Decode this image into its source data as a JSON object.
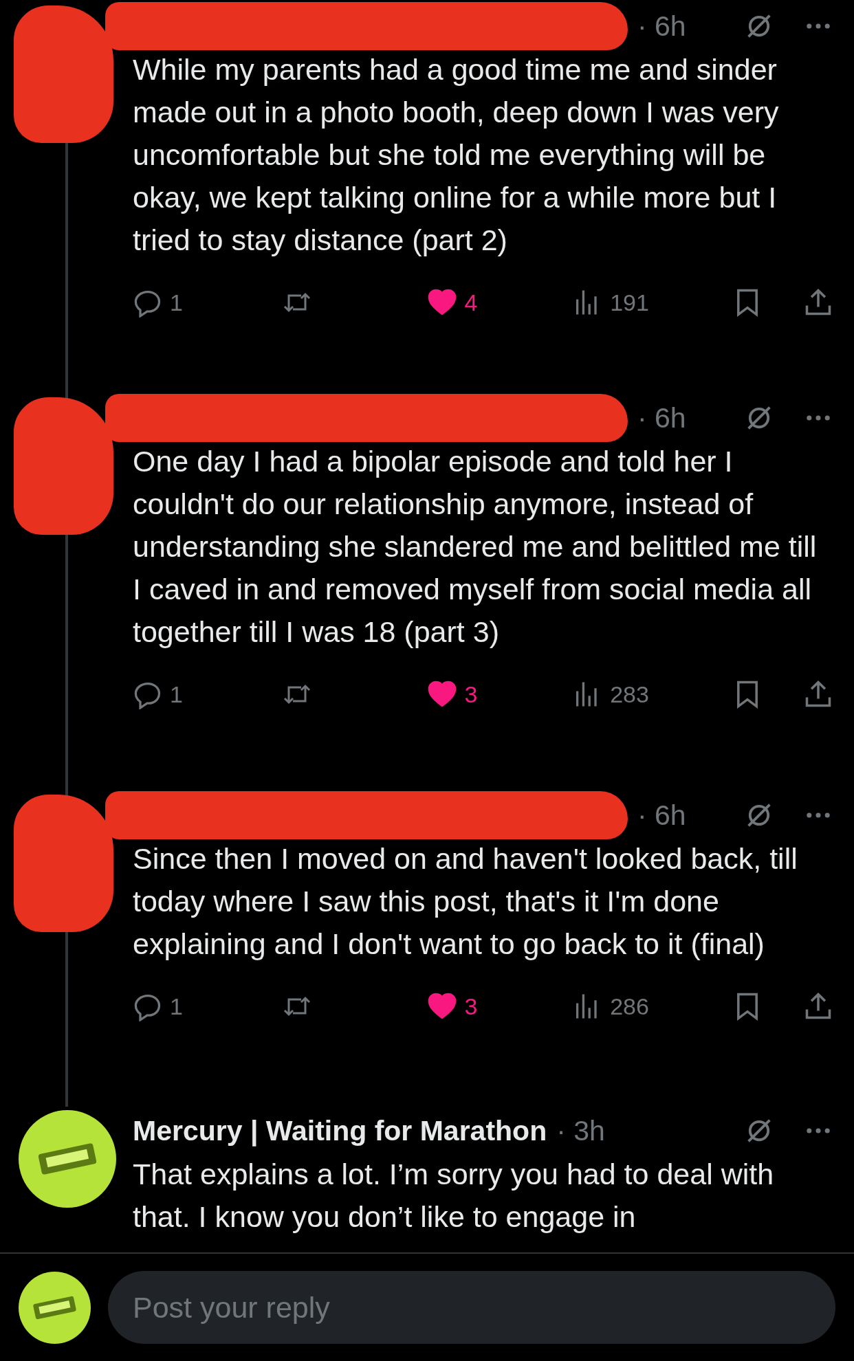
{
  "tweets": [
    {
      "author_redacted": true,
      "time": "· 6h",
      "text": "While my parents had a good time me and sinder made out in a photo booth, deep down I was very uncomfortable but she told me everything will be okay, we kept talking online for a while more but I tried to stay distance (part 2)",
      "replies": "1",
      "likes": "4",
      "liked": true,
      "views": "191",
      "thread": true
    },
    {
      "author_redacted": true,
      "time": "· 6h",
      "text": "One day I had a bipolar episode and told her I couldn't do our relationship anymore, instead of understanding she slandered me and belittled me till I caved in and removed myself from social media all together till I was 18 (part 3)",
      "replies": "1",
      "likes": "3",
      "liked": true,
      "views": "283",
      "thread": true
    },
    {
      "author_redacted": true,
      "time": "· 6h",
      "text": "Since then I moved on and haven't looked back, till today where I saw this post, that's it I'm done explaining and I don't want to go back to it (final)",
      "replies": "1",
      "likes": "3",
      "liked": true,
      "views": "286",
      "thread": true
    },
    {
      "author_redacted": false,
      "author": "Mercury | Waiting for Marathon",
      "time": "· 3h",
      "text": "That explains a lot. I’m sorry you had to deal with that. I know you don’t like to engage in",
      "thread": false
    }
  ],
  "composer": {
    "placeholder": "Post your reply"
  }
}
